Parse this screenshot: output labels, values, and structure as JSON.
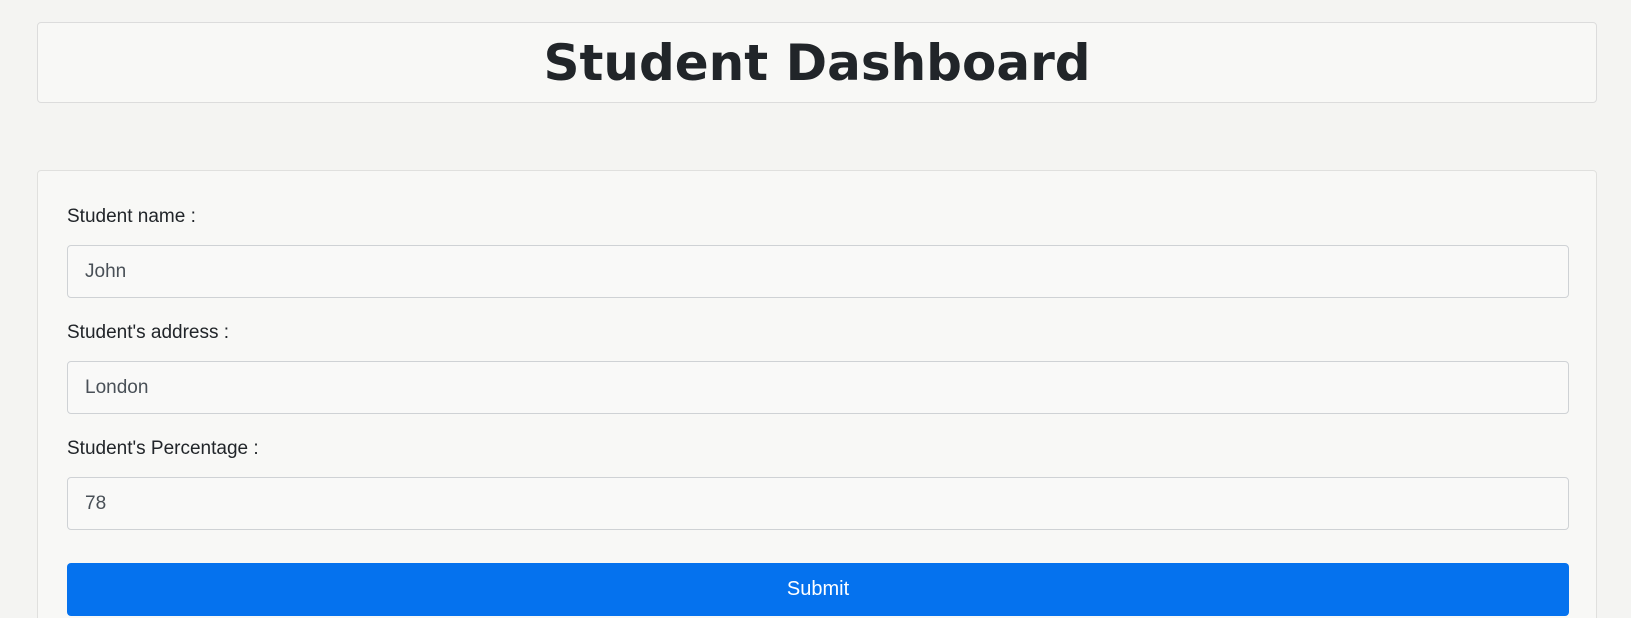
{
  "header": {
    "title": "Student Dashboard"
  },
  "form": {
    "fields": [
      {
        "label": "Student name :",
        "value": "John"
      },
      {
        "label": "Student's address :",
        "value": "London"
      },
      {
        "label": "Student's Percentage :",
        "value": "78"
      }
    ],
    "submit_label": "Submit"
  },
  "colors": {
    "primary_button": "#0572ee",
    "background": "#f4f4f2"
  }
}
